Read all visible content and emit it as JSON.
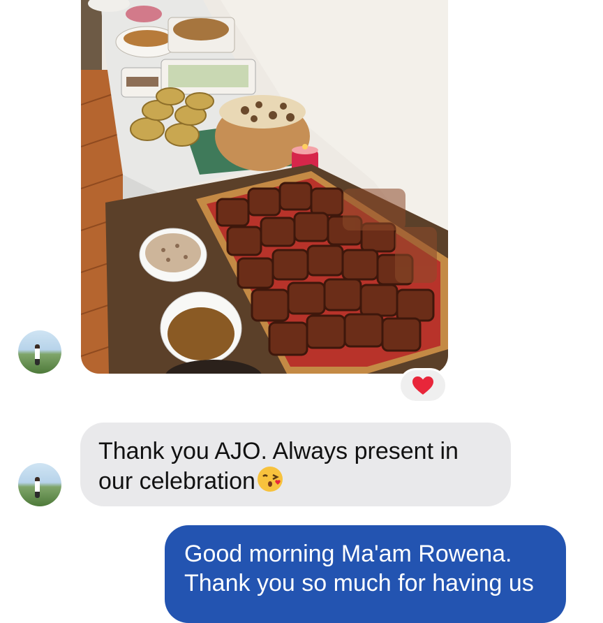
{
  "conversation": {
    "shared_photo": {
      "alt": "Buffet table with roasted lechon on a wooden board",
      "reaction": "heart-reaction"
    },
    "incoming_message": {
      "line1": "Thank you AJO. Always present in",
      "line2": "our celebration",
      "emoji": "kissing-face-emoji"
    },
    "outgoing_message": {
      "line1": "Good morning Ma'am Rowena.",
      "line2": "Thank you so much for having us"
    }
  },
  "colors": {
    "outgoing_bubble": "#2354b1",
    "incoming_bubble": "#e9e9eb",
    "heart": "#e8263a"
  }
}
